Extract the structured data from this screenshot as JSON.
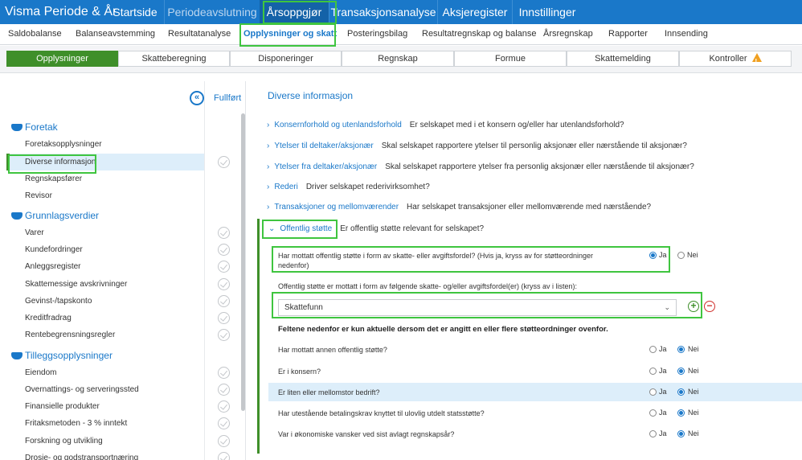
{
  "app": {
    "title": "Visma Periode & År"
  },
  "topnav": [
    {
      "label": "Startside",
      "state": "normal"
    },
    {
      "label": "Periodeavslutning",
      "state": "muted"
    },
    {
      "label": "Årsoppgjør",
      "state": "active"
    },
    {
      "label": "Transaksjonsanalyse",
      "state": "normal"
    },
    {
      "label": "Aksjeregister",
      "state": "normal"
    },
    {
      "label": "Innstillinger",
      "state": "normal"
    }
  ],
  "subnav": [
    "Saldobalanse",
    "Balanseavstemming",
    "Resultatanalyse",
    "Opplysninger og skatt",
    "Posteringsbilag",
    "Resultatregnskap og balanse",
    "Årsregnskap",
    "Rapporter",
    "Innsending"
  ],
  "subnav_active": "Opplysninger og skatt",
  "tabs": [
    "Opplysninger",
    "Skatteberegning",
    "Disponeringer",
    "Regnskap",
    "Formue",
    "Skattemelding",
    "Kontroller"
  ],
  "left": {
    "collapse_icon": "double-chevron-left-icon",
    "column_header": "Fullført",
    "groups": [
      {
        "label": "Foretak",
        "items": [
          "Foretaksopplysninger",
          "Diverse informasjon",
          "Regnskapsfører",
          "Revisor"
        ]
      },
      {
        "label": "Grunnlagsverdier",
        "items": [
          "Varer",
          "Kundefordringer",
          "Anleggsregister",
          "Skattemessige avskrivninger",
          "Gevinst-/tapskonto",
          "Kreditfradrag",
          "Rentebegrensningsregler"
        ]
      },
      {
        "label": "Tilleggsopplysninger",
        "items": [
          "Eiendom",
          "Overnattings- og serveringssted",
          "Finansielle produkter",
          "Fritaksmetoden - 3 % inntekt",
          "Forskning og utvikling",
          "Drosje- og godstransportnæring"
        ]
      }
    ],
    "selected_item": "Diverse informasjon"
  },
  "right": {
    "title": "Diverse informasjon",
    "sections": [
      {
        "link": "Konsernforhold og utenlandsforhold",
        "question": "Er selskapet med i et konsern og/eller har utenlandsforhold?"
      },
      {
        "link": "Ytelser til deltaker/aksjonær",
        "question": "Skal selskapet rapportere ytelser til personlig aksjonær eller nærstående til aksjonær?"
      },
      {
        "link": "Ytelser fra deltaker/aksjonær",
        "question": "Skal selskapet rapportere ytelser fra personlig aksjonær eller nærstående til aksjonær?"
      },
      {
        "link": "Rederi",
        "question": "Driver selskapet rederivirksomhet?"
      },
      {
        "link": "Transaksjoner og mellomværender",
        "question": "Har selskapet transaksjoner eller mellomværende med nærstående?"
      }
    ],
    "expanded": {
      "link": "Offentlig støtte",
      "question": "Er offentlig støtte relevant for selskapet?",
      "main_question": "Har mottatt offentlig støtte i form av skatte- eller avgiftsfordel? (Hvis ja, kryss av for støtteordninger nedenfor)",
      "main_answer": "Ja",
      "list_label": "Offentlig støtte er mottatt i form av følgende skatte- og/eller avgiftsfordel(er) (kryss av i listen):",
      "select_value": "Skattefunn",
      "note": "Feltene nedenfor er kun aktuelle dersom det er angitt en eller flere støtteordninger ovenfor.",
      "sub_questions": [
        {
          "q": "Har mottatt annen offentlig støtte?",
          "answer": "Nei"
        },
        {
          "q": "Er i konsern?",
          "answer": "Nei"
        },
        {
          "q": "Er liten eller mellomstor bedrift?",
          "answer": "Nei"
        },
        {
          "q": "Har utestående betalingskrav knyttet til ulovlig utdelt statsstøtte?",
          "answer": "Nei"
        },
        {
          "q": "Var i økonomiske vansker ved sist avlagt regnskapsår?",
          "answer": "Nei"
        }
      ],
      "yes_label": "Ja",
      "no_label": "Nei"
    }
  }
}
